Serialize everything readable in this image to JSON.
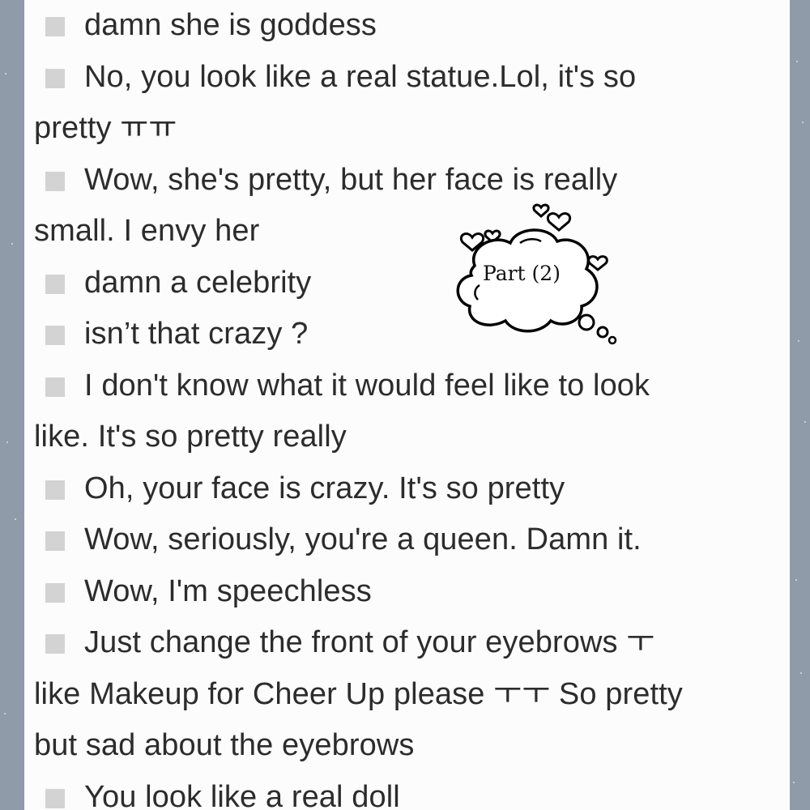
{
  "comments": [
    {
      "text": "damn she is goddess",
      "bullet": true
    },
    {
      "text": "No, you look like a real statue.Lol, it's so",
      "bullet": true
    },
    {
      "text": "pretty ㅠㅠ",
      "bullet": false
    },
    {
      "text": "Wow, she's pretty, but her face is really",
      "bullet": true
    },
    {
      "text": "small. I envy her",
      "bullet": false
    },
    {
      "text": "damn a celebrity",
      "bullet": true
    },
    {
      "text": "isn’t that crazy ?",
      "bullet": true
    },
    {
      "text": "I don't know what it would feel like to look",
      "bullet": true
    },
    {
      "text": "like. It's so pretty really",
      "bullet": false
    },
    {
      "text": "Oh, your face is crazy. It's so pretty",
      "bullet": true
    },
    {
      "text": "Wow, seriously, you're a queen. Damn it.",
      "bullet": true
    },
    {
      "text": "Wow, I'm speechless",
      "bullet": true
    },
    {
      "text": "Just change the front of your eyebrows ㅜ",
      "bullet": true
    },
    {
      "text": "like Makeup for Cheer Up please ㅜㅜ So pretty",
      "bullet": false
    },
    {
      "text": "but sad about the eyebrows",
      "bullet": false
    },
    {
      "text": "You look like a real doll",
      "bullet": true
    }
  ],
  "sticker": {
    "label": "Part (2)"
  },
  "colors": {
    "background": "#8f9ba9",
    "sheet": "#fcfcfc",
    "text": "#2c2c2c",
    "bullet": "#d3d3d3"
  }
}
